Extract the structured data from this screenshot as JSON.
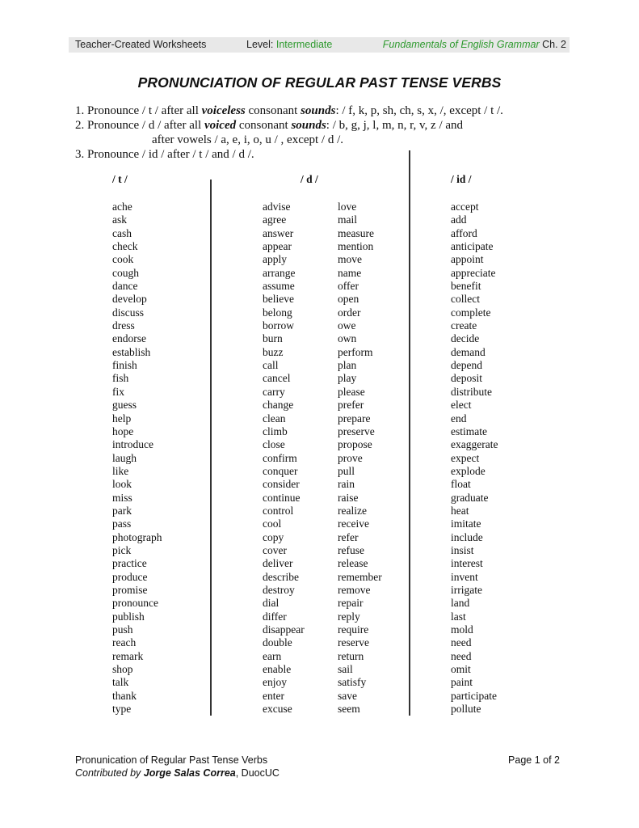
{
  "header": {
    "left": "Teacher-Created Worksheets",
    "level_label": "Level: ",
    "level_value": "Intermediate",
    "book_title": "Fundamentals of English Grammar",
    "chapter": " Ch. 2",
    "accent_color": "#2e9a2e",
    "bar_color": "#e8e8e8"
  },
  "title": "PRONUNCIATION OF REGULAR PAST TENSE VERBS",
  "rules": [
    {
      "prefix": "1. Pronounce / t  / after all ",
      "em1": "voiceless",
      "mid": " consonant ",
      "em2": "sounds",
      "suffix": ": / f, k, p, sh, ch, s, x,  /, except / t /."
    },
    {
      "prefix": "2. Pronounce / d / after all ",
      "em1": "voiced",
      "mid": " consonant ",
      "em2": "sounds",
      "suffix": ": / b, g, j, l, m, n, r, v, z / and",
      "continuation": "after vowels / a, e, i, o, u / , except / d /."
    },
    {
      "text": "3. Pronounce / id / after / t / and / d /."
    }
  ],
  "columns": {
    "t": {
      "heading": "/ t /",
      "words": [
        "ache",
        "ask",
        "cash",
        "check",
        "cook",
        "cough",
        "dance",
        "develop",
        "discuss",
        "dress",
        "endorse",
        "establish",
        "finish",
        "fish",
        "fix",
        "guess",
        "help",
        "hope",
        "introduce",
        "laugh",
        "like",
        "look",
        "miss",
        "park",
        "pass",
        "photograph",
        "pick",
        "practice",
        "produce",
        "promise",
        "pronounce",
        "publish",
        "push",
        "reach",
        "remark",
        "shop",
        "talk",
        "thank",
        "type"
      ]
    },
    "d": {
      "heading": "/ d /",
      "words_a": [
        "advise",
        "agree",
        "answer",
        "appear",
        "apply",
        "arrange",
        "assume",
        "believe",
        "belong",
        "borrow",
        "burn",
        "buzz",
        "call",
        "cancel",
        "carry",
        "change",
        "clean",
        "climb",
        "close",
        "confirm",
        "conquer",
        "consider",
        "continue",
        "control",
        "cool",
        "copy",
        "cover",
        "deliver",
        "describe",
        "destroy",
        "dial",
        "differ",
        "disappear",
        "double",
        "earn",
        "enable",
        "enjoy",
        "enter",
        "excuse"
      ],
      "words_b": [
        "love",
        "mail",
        "measure",
        "mention",
        "move",
        "name",
        "offer",
        "open",
        "order",
        "owe",
        "own",
        "perform",
        "plan",
        "play",
        "please",
        "prefer",
        "prepare",
        "preserve",
        "propose",
        "prove",
        "pull",
        "rain",
        "raise",
        "realize",
        "receive",
        "refer",
        "refuse",
        "release",
        "remember",
        "remove",
        "repair",
        "reply",
        "require",
        "reserve",
        "return",
        "sail",
        "satisfy",
        "save",
        "seem"
      ]
    },
    "id": {
      "heading": "/ id /",
      "words": [
        "accept",
        "add",
        "afford",
        "anticipate",
        "appoint",
        "appreciate",
        "benefit",
        "collect",
        "complete",
        "create",
        "decide",
        "demand",
        "depend",
        "deposit",
        "distribute",
        "elect",
        "end",
        "estimate",
        "exaggerate",
        "expect",
        "explode",
        "float",
        "graduate",
        "heat",
        "imitate",
        "include",
        "insist",
        "interest",
        "invent",
        "irrigate",
        "land",
        "last",
        "mold",
        "need",
        "need",
        "omit",
        "paint",
        "participate",
        "pollute"
      ]
    }
  },
  "footer": {
    "doc_title": "Pronunication of Regular Past Tense Verbs",
    "contributed_by": "Contributed by ",
    "author": "Jorge Salas Correa",
    "institution": ", DuocUC",
    "page": "Page 1 of 2"
  }
}
